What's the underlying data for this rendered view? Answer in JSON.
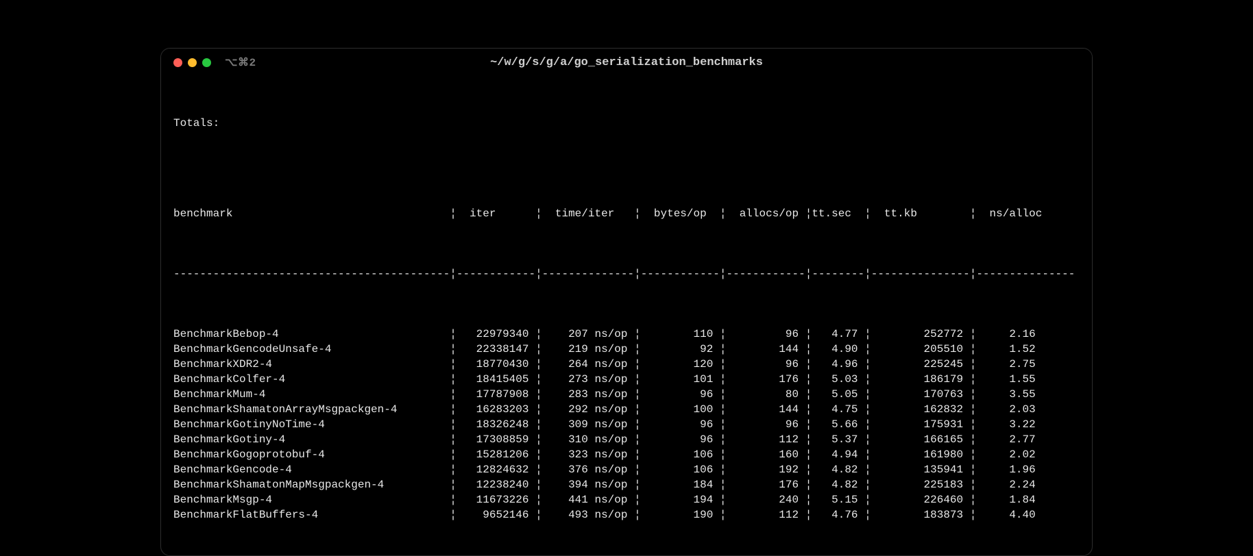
{
  "window": {
    "tab_hint": "⌥⌘2",
    "title": "~/w/g/s/g/a/go_serialization_benchmarks"
  },
  "section_label": "Totals:",
  "headers": {
    "name": "benchmark",
    "iter": "iter",
    "time": "time/iter",
    "bytes": "bytes/op",
    "allocs": "allocs/op",
    "ttsec": "tt.sec",
    "ttkb": "tt.kb",
    "nsalloc": "ns/alloc"
  },
  "rows": [
    {
      "name": "BenchmarkBebop-4",
      "iter": "22979340",
      "time": "207 ns/op",
      "bytes": "110",
      "allocs": "96",
      "ttsec": "4.77",
      "ttkb": "252772",
      "nsalloc": "2.16"
    },
    {
      "name": "BenchmarkGencodeUnsafe-4",
      "iter": "22338147",
      "time": "219 ns/op",
      "bytes": "92",
      "allocs": "144",
      "ttsec": "4.90",
      "ttkb": "205510",
      "nsalloc": "1.52"
    },
    {
      "name": "BenchmarkXDR2-4",
      "iter": "18770430",
      "time": "264 ns/op",
      "bytes": "120",
      "allocs": "96",
      "ttsec": "4.96",
      "ttkb": "225245",
      "nsalloc": "2.75"
    },
    {
      "name": "BenchmarkColfer-4",
      "iter": "18415405",
      "time": "273 ns/op",
      "bytes": "101",
      "allocs": "176",
      "ttsec": "5.03",
      "ttkb": "186179",
      "nsalloc": "1.55"
    },
    {
      "name": "BenchmarkMum-4",
      "iter": "17787908",
      "time": "283 ns/op",
      "bytes": "96",
      "allocs": "80",
      "ttsec": "5.05",
      "ttkb": "170763",
      "nsalloc": "3.55"
    },
    {
      "name": "BenchmarkShamatonArrayMsgpackgen-4",
      "iter": "16283203",
      "time": "292 ns/op",
      "bytes": "100",
      "allocs": "144",
      "ttsec": "4.75",
      "ttkb": "162832",
      "nsalloc": "2.03"
    },
    {
      "name": "BenchmarkGotinyNoTime-4",
      "iter": "18326248",
      "time": "309 ns/op",
      "bytes": "96",
      "allocs": "96",
      "ttsec": "5.66",
      "ttkb": "175931",
      "nsalloc": "3.22"
    },
    {
      "name": "BenchmarkGotiny-4",
      "iter": "17308859",
      "time": "310 ns/op",
      "bytes": "96",
      "allocs": "112",
      "ttsec": "5.37",
      "ttkb": "166165",
      "nsalloc": "2.77"
    },
    {
      "name": "BenchmarkGogoprotobuf-4",
      "iter": "15281206",
      "time": "323 ns/op",
      "bytes": "106",
      "allocs": "160",
      "ttsec": "4.94",
      "ttkb": "161980",
      "nsalloc": "2.02"
    },
    {
      "name": "BenchmarkGencode-4",
      "iter": "12824632",
      "time": "376 ns/op",
      "bytes": "106",
      "allocs": "192",
      "ttsec": "4.82",
      "ttkb": "135941",
      "nsalloc": "1.96"
    },
    {
      "name": "BenchmarkShamatonMapMsgpackgen-4",
      "iter": "12238240",
      "time": "394 ns/op",
      "bytes": "184",
      "allocs": "176",
      "ttsec": "4.82",
      "ttkb": "225183",
      "nsalloc": "2.24"
    },
    {
      "name": "BenchmarkMsgp-4",
      "iter": "11673226",
      "time": "441 ns/op",
      "bytes": "194",
      "allocs": "240",
      "ttsec": "5.15",
      "ttkb": "226460",
      "nsalloc": "1.84"
    },
    {
      "name": "BenchmarkFlatBuffers-4",
      "iter": "9652146",
      "time": "493 ns/op",
      "bytes": "190",
      "allocs": "112",
      "ttsec": "4.76",
      "ttkb": "183873",
      "nsalloc": "4.40"
    }
  ],
  "sep": "¦",
  "dash": "-"
}
